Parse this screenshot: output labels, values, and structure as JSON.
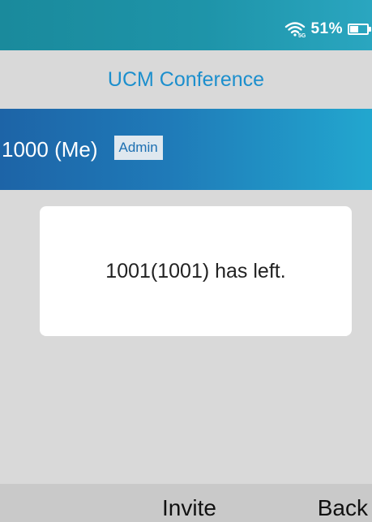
{
  "status_bar": {
    "wifi_icon": "wifi-5g-icon",
    "wifi_label": "5G",
    "battery_percent": "51%",
    "battery_level": 0.51,
    "battery_icon": "battery-icon"
  },
  "header": {
    "title": "UCM Conference"
  },
  "participant": {
    "name": "1000 (Me)",
    "role_badge": "Admin"
  },
  "dialog": {
    "message": "1001(1001) has left."
  },
  "softkeys": {
    "invite_label": "Invite",
    "back_label": "Back"
  },
  "colors": {
    "accent": "#1c8fcd",
    "header_gradient_start": "#1d64a7",
    "header_gradient_end": "#22a7cf",
    "background": "#d9d9d9"
  }
}
